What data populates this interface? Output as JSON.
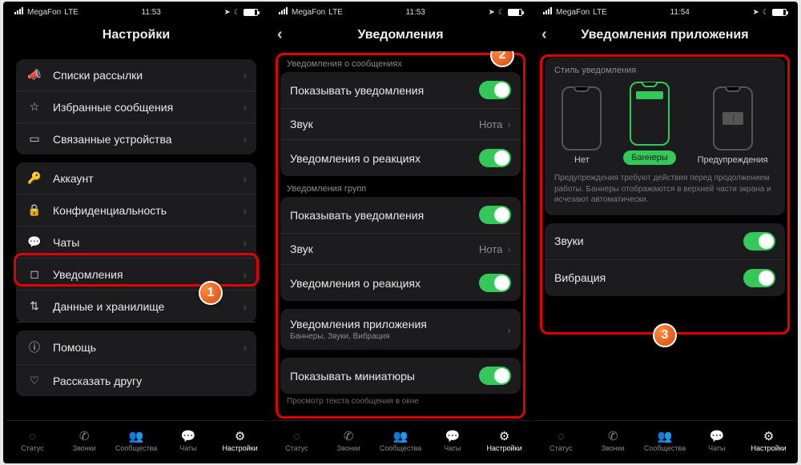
{
  "statusbar": {
    "carrier": "MegaFon",
    "network": "LTE",
    "time1": "11:53",
    "time2": "11:53",
    "time3": "11:54"
  },
  "p1": {
    "title": "Настройки",
    "g1": [
      {
        "icon": "megaphone",
        "label": "Списки рассылки"
      },
      {
        "icon": "star",
        "label": "Избранные сообщения"
      },
      {
        "icon": "laptop",
        "label": "Связанные устройства"
      }
    ],
    "g2": [
      {
        "icon": "key",
        "label": "Аккаунт"
      },
      {
        "icon": "lock",
        "label": "Конфиденциальность"
      },
      {
        "icon": "chat",
        "label": "Чаты"
      },
      {
        "icon": "bell",
        "label": "Уведомления"
      },
      {
        "icon": "updown",
        "label": "Данные и хранилище"
      }
    ],
    "g3": [
      {
        "icon": "info",
        "label": "Помощь"
      },
      {
        "icon": "heart",
        "label": "Рассказать другу"
      }
    ]
  },
  "p2": {
    "title": "Уведомления",
    "sec_msg": "Уведомления о сообщениях",
    "sec_grp": "Уведомления групп",
    "show_notif": "Показывать уведомления",
    "sound": "Звук",
    "sound_val": "Нота",
    "react": "Уведомления о реакциях",
    "app_notif": "Уведомления приложения",
    "app_notif_sub": "Баннеры, Звуки, Вибрация",
    "show_thumb": "Показывать миниатюры",
    "hint": "Просмотр текста сообщения в окне"
  },
  "p3": {
    "title": "Уведомления приложения",
    "style_title": "Стиль уведомления",
    "opt_none": "Нет",
    "opt_banner": "Баннеры",
    "opt_alert": "Предупреждения",
    "desc": "Предупреждения требуют действия перед продолжением работы. Баннеры отображаются в верхней части экрана и исчезают автоматически.",
    "sounds": "Звуки",
    "vibration": "Вибрация"
  },
  "tabs": {
    "status": "Статус",
    "calls": "Звонки",
    "community": "Сообщества",
    "chats": "Чаты",
    "settings": "Настройки"
  },
  "badges": {
    "b1": "1",
    "b2": "2",
    "b3": "3"
  }
}
